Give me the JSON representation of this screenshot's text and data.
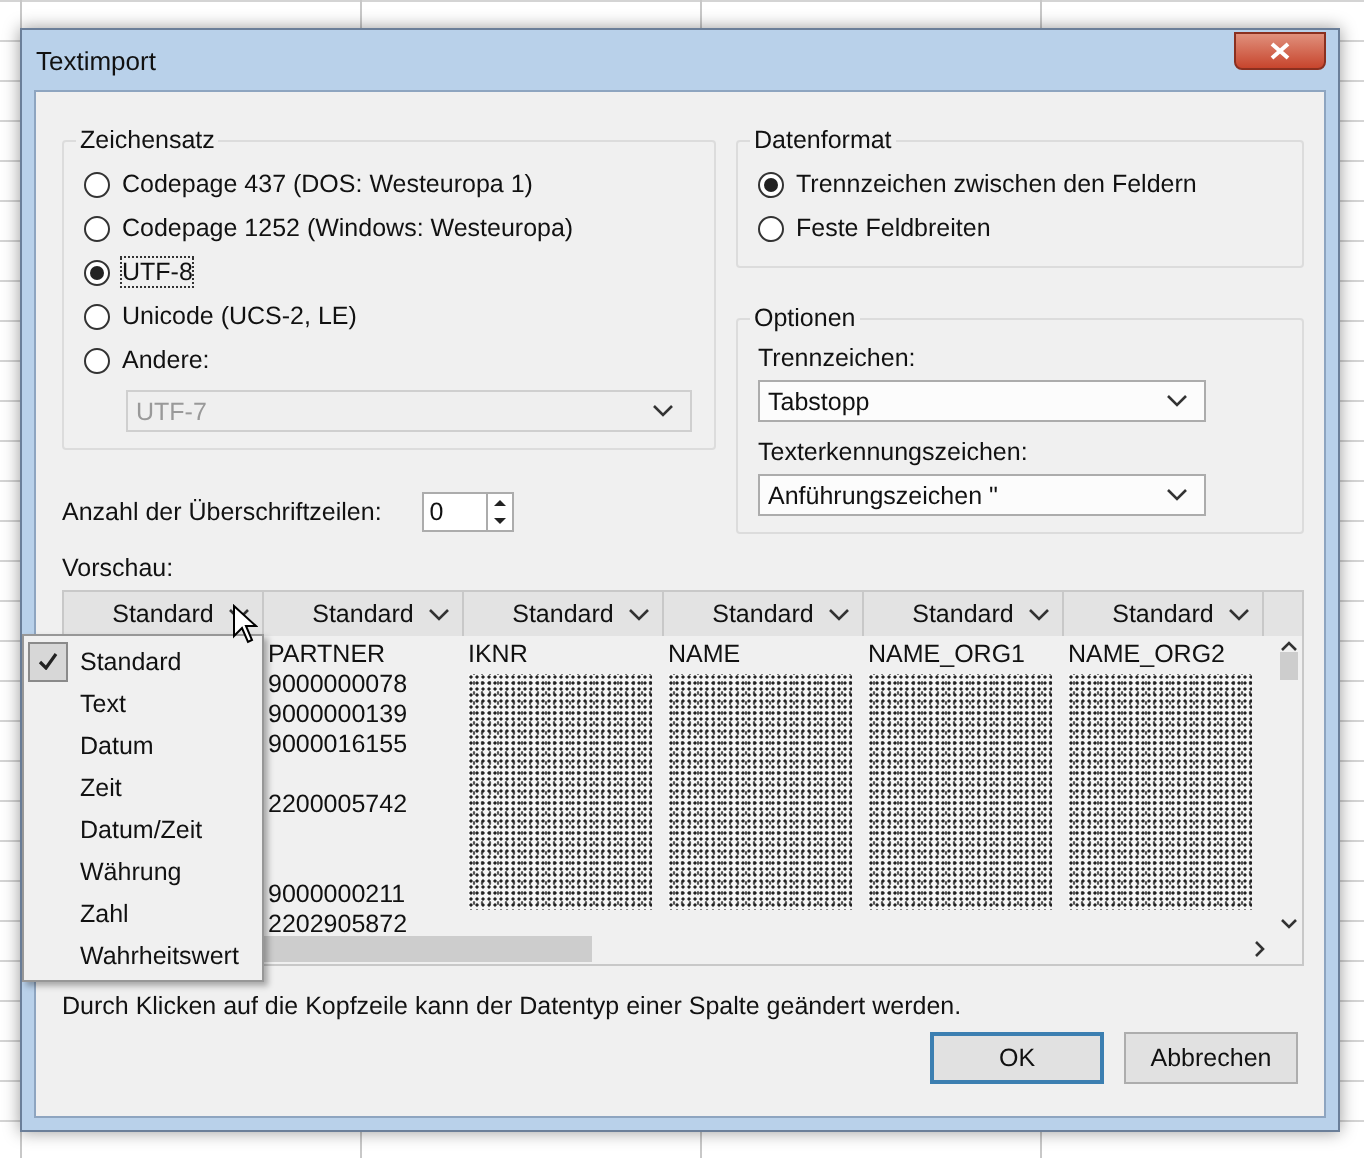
{
  "window": {
    "title": "Textimport"
  },
  "charset": {
    "title": "Zeichensatz",
    "options": [
      {
        "label": "Codepage 437 (DOS: Westeuropa 1)",
        "selected": false
      },
      {
        "label": "Codepage 1252 (Windows: Westeuropa)",
        "selected": false
      },
      {
        "label": "UTF-8",
        "selected": true
      },
      {
        "label": "Unicode (UCS-2, LE)",
        "selected": false
      },
      {
        "label": "Andere:",
        "selected": false
      }
    ],
    "other_dropdown": {
      "value": "UTF-7",
      "disabled": true
    }
  },
  "header_rows": {
    "label": "Anzahl der Überschriftzeilen:",
    "value": "0"
  },
  "data_format": {
    "title": "Datenformat",
    "options": [
      {
        "label": "Trennzeichen zwischen den Feldern",
        "selected": true
      },
      {
        "label": "Feste Feldbreiten",
        "selected": false
      }
    ]
  },
  "options": {
    "title": "Optionen",
    "delimiter": {
      "label": "Trennzeichen:",
      "value": "Tabstopp"
    },
    "text_qualifier": {
      "label": "Texterkennungszeichen:",
      "value": "Anführungszeichen \""
    }
  },
  "preview": {
    "label": "Vorschau:",
    "columns": [
      {
        "type": "Standard"
      },
      {
        "type": "Standard",
        "heading": "PARTNER",
        "values": [
          {
            "text": "9000000078",
            "gap_above": false,
            "gap_below": false
          },
          {
            "text": "9000000139",
            "gap_above": false,
            "gap_below": false
          },
          {
            "text": "9000016155",
            "gap_above": false,
            "gap_below": false
          },
          {
            "text": "2200005742",
            "gap_above": true,
            "gap_below": true
          },
          {
            "text": "9000000211",
            "gap_above": true,
            "gap_below": false
          },
          {
            "text": "2202905872",
            "gap_above": false,
            "gap_below": false
          }
        ]
      },
      {
        "type": "Standard",
        "heading": "IKNR",
        "obscured": true
      },
      {
        "type": "Standard",
        "heading": "NAME",
        "obscured": true
      },
      {
        "type": "Standard",
        "heading": "NAME_ORG1",
        "obscured": true
      },
      {
        "type": "Standard",
        "heading": "NAME_ORG2",
        "obscured": true
      }
    ],
    "type_menu": [
      {
        "label": "Standard",
        "selected": true
      },
      {
        "label": "Text",
        "selected": false
      },
      {
        "label": "Datum",
        "selected": false
      },
      {
        "label": "Zeit",
        "selected": false
      },
      {
        "label": "Datum/Zeit",
        "selected": false
      },
      {
        "label": "Währung",
        "selected": false
      },
      {
        "label": "Zahl",
        "selected": false
      },
      {
        "label": "Wahrheitswert",
        "selected": false
      }
    ]
  },
  "hint": "Durch Klicken auf die Kopfzeile kann der Datentyp einer Spalte geändert werden.",
  "buttons": [
    {
      "label": "OK",
      "default": true
    },
    {
      "label": "Abbrechen",
      "default": false
    }
  ]
}
